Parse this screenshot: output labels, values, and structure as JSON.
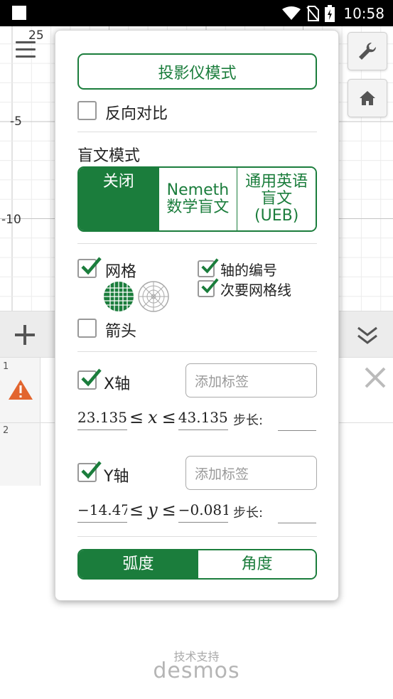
{
  "status_bar": {
    "time": "10:58"
  },
  "graph": {
    "x_tick_top": "25",
    "y_tick_labels": [
      "-5",
      "-10"
    ]
  },
  "popup": {
    "projector_mode_label": "投影仪模式",
    "reverse_contrast_label": "反向对比",
    "braille_mode_label": "盲文模式",
    "braille_options": [
      {
        "label": "关闭",
        "active": true
      },
      {
        "label": "Nemeth 数学盲文",
        "active": false
      },
      {
        "label": "通用英语盲文 (UEB)",
        "active": false
      }
    ],
    "grid_label": "网格",
    "grid_checked": true,
    "axis_numbers_label": "轴的编号",
    "axis_numbers_checked": true,
    "minor_gridlines_label": "次要网格线",
    "minor_gridlines_checked": true,
    "arrows_label": "箭头",
    "arrows_checked": false,
    "x_axis": {
      "label": "X轴",
      "checked": true,
      "label_placeholder": "添加标签",
      "min": "23.135",
      "max": "43.135",
      "var": "x",
      "step_label": "步长:"
    },
    "y_axis": {
      "label": "Y轴",
      "checked": true,
      "label_placeholder": "添加标签",
      "min": "−14.47",
      "max": "−0.081",
      "var": "y",
      "step_label": "步长:"
    },
    "angle_options": [
      {
        "label": "弧度",
        "active": true
      },
      {
        "label": "角度",
        "active": false
      }
    ]
  },
  "expressions": {
    "row_numbers": [
      "1",
      "2"
    ]
  },
  "footer": {
    "powered_by": "技术支持",
    "brand": "desmos"
  },
  "colors": {
    "accent": "#1b7d3c",
    "warning": "#e2652f"
  }
}
